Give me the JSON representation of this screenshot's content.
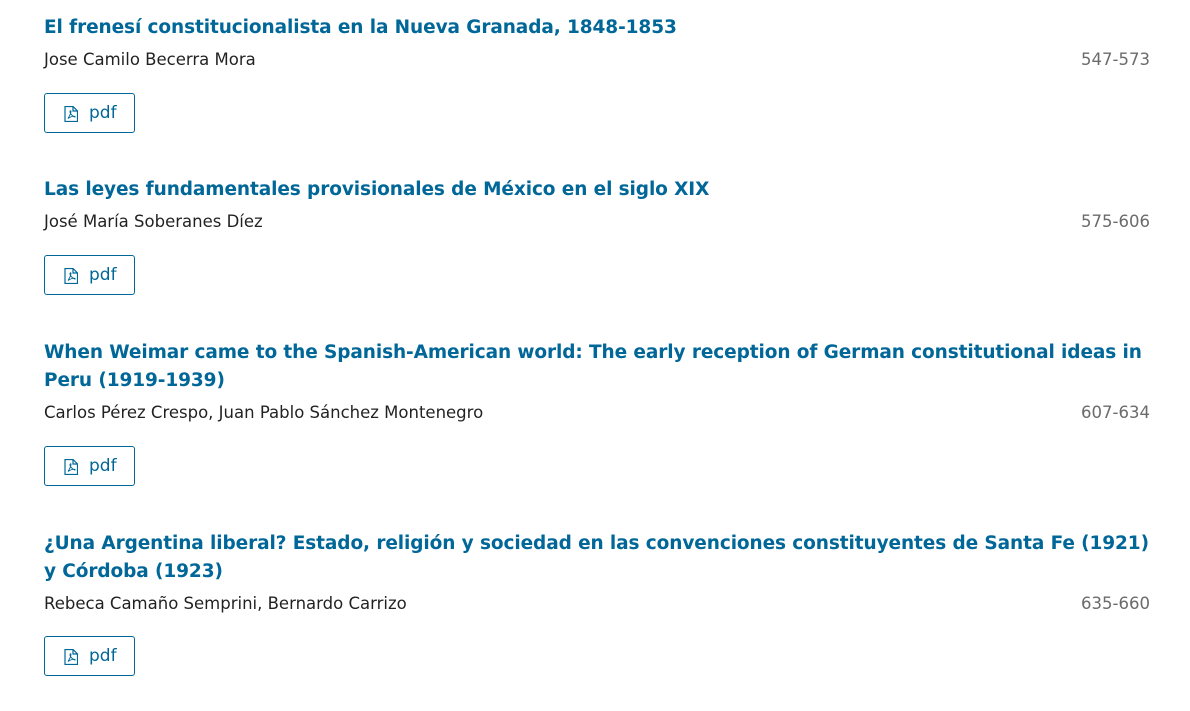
{
  "articles": [
    {
      "title": "El frenesí constitucionalista en la Nueva Granada, 1848-1853",
      "authors": "Jose Camilo Becerra Mora",
      "pages": "547-573",
      "galley_label": "pdf",
      "galley_icon": "file-pdf-icon"
    },
    {
      "title": "Las leyes fundamentales provisionales de México en el siglo XIX",
      "authors": "José María Soberanes Díez",
      "pages": "575-606",
      "galley_label": "pdf",
      "galley_icon": "file-pdf-icon"
    },
    {
      "title": "When Weimar came to the Spanish-American world: The early reception of German constitutional ideas in Peru (1919-1939)",
      "authors": "Carlos Pérez Crespo, Juan Pablo Sánchez Montenegro",
      "pages": "607-634",
      "galley_label": "pdf",
      "galley_icon": "file-pdf-icon"
    },
    {
      "title": "¿Una Argentina liberal? Estado, religión y sociedad en las convenciones constituyentes de Santa Fe (1921) y Córdoba (1923)",
      "authors": "Rebeca Camaño Semprini, Bernardo Carrizo",
      "pages": "635-660",
      "galley_label": "pdf",
      "galley_icon": "file-pdf-icon"
    }
  ],
  "colors": {
    "link": "#006798",
    "text": "#222222",
    "muted": "#6b6b6b"
  }
}
